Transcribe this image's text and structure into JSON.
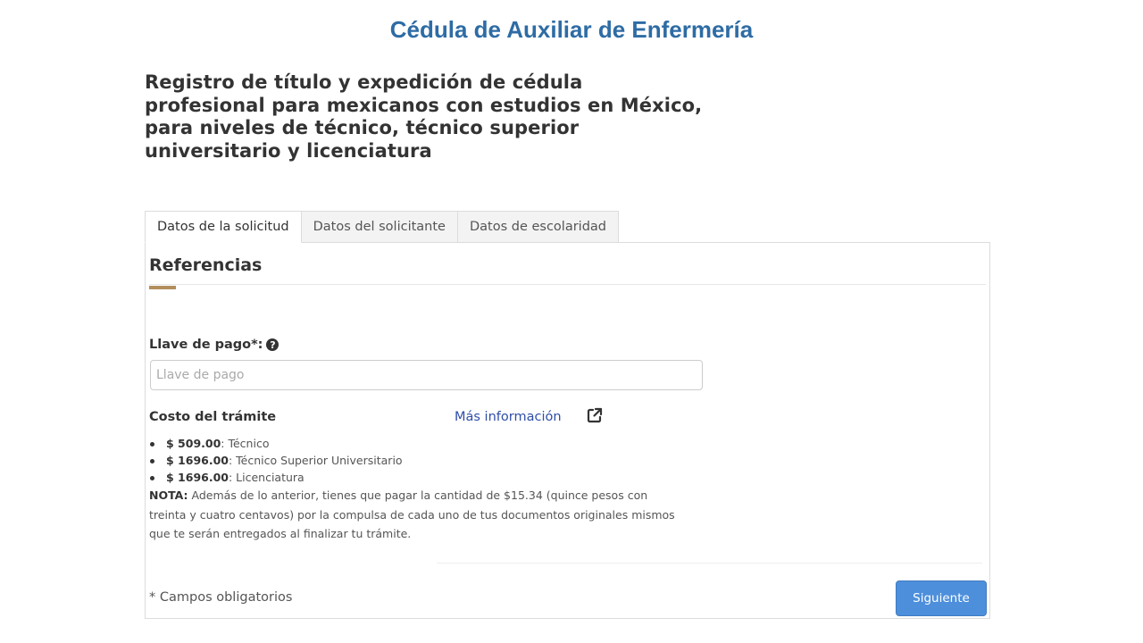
{
  "slide": {
    "title": "Cédula de Auxiliar de Enfermería"
  },
  "page": {
    "heading_lines": [
      "Registro de título y expedición de cédula",
      "profesional para mexicanos con estudios en México,",
      "para niveles de técnico, técnico superior",
      "universitario y licenciatura"
    ]
  },
  "tabs": [
    {
      "label": "Datos de la solicitud",
      "active": true
    },
    {
      "label": "Datos del solicitante",
      "active": false
    },
    {
      "label": "Datos de escolaridad",
      "active": false
    }
  ],
  "form": {
    "section_title": "Referencias",
    "payment_key": {
      "label": "Llave de pago*:",
      "placeholder": "Llave de pago",
      "value": "",
      "help_icon": "question-circle-icon"
    },
    "cost": {
      "label": "Costo del trámite",
      "more_info_link": "Más información",
      "more_info_icon": "external-link-icon",
      "prices": [
        {
          "amount": "$ 509.00",
          "level": ": Técnico"
        },
        {
          "amount": "$ 1696.00",
          "level": ": Técnico Superior Universitario"
        },
        {
          "amount": "$ 1696.00",
          "level": ": Licenciatura"
        }
      ],
      "note_label": "NOTA:",
      "note_text": " Además de lo anterior, tienes que pagar la cantidad de $15.34 (quince pesos con treinta y cuatro centavos) por la compulsa de cada uno de tus documentos originales mismos que te serán entregados al finalizar tu trámite."
    },
    "required_note": "* Campos obligatorios",
    "next_button": "Siguiente"
  },
  "colors": {
    "title_blue": "#2e6ca4",
    "accent_gold": "#b38e5d",
    "link_blue": "#2e4ea8",
    "button_blue": "#4d8fdb"
  }
}
